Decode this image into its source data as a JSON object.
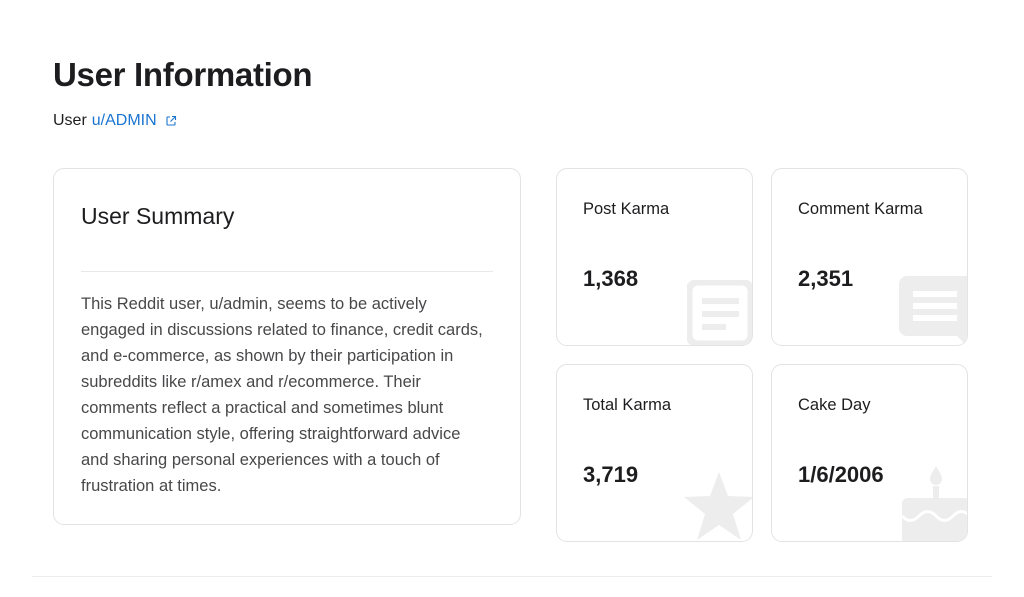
{
  "header": {
    "title": "User Information",
    "user_prefix": "User",
    "username_link": "u/ADMIN"
  },
  "summary": {
    "title": "User Summary",
    "text": "This Reddit user, u/admin, seems to be actively engaged in discussions related to finance, credit cards, and e-commerce, as shown by their participation in subreddits like r/amex and r/ecommerce. Their comments reflect a practical and sometimes blunt communication style, offering straightforward advice and sharing personal experiences with a touch of frustration at times."
  },
  "stats": [
    {
      "label": "Post Karma",
      "value": "1,368",
      "icon": "document-icon"
    },
    {
      "label": "Comment Karma",
      "value": "2,351",
      "icon": "comment-icon"
    },
    {
      "label": "Total Karma",
      "value": "3,719",
      "icon": "star-icon"
    },
    {
      "label": "Cake Day",
      "value": "1/6/2006",
      "icon": "cake-icon"
    }
  ],
  "colors": {
    "link": "#1b75d0",
    "card_border": "#e3e3e6",
    "watermark_icon": "#ededee"
  }
}
